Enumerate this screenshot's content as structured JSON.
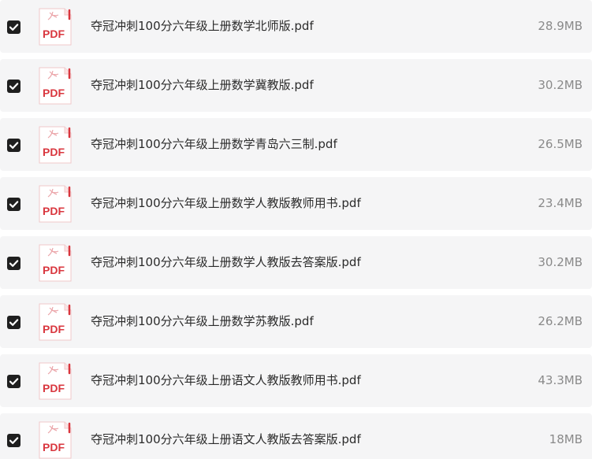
{
  "files": [
    {
      "name": "夺冠冲刺100分六年级上册数学北师版.pdf",
      "size": "28.9MB",
      "checked": true,
      "icon": "pdf-icon",
      "icon_label": "PDF"
    },
    {
      "name": "夺冠冲刺100分六年级上册数学冀教版.pdf",
      "size": "30.2MB",
      "checked": true,
      "icon": "pdf-icon",
      "icon_label": "PDF"
    },
    {
      "name": "夺冠冲刺100分六年级上册数学青岛六三制.pdf",
      "size": "26.5MB",
      "checked": true,
      "icon": "pdf-icon",
      "icon_label": "PDF"
    },
    {
      "name": "夺冠冲刺100分六年级上册数学人教版教师用书.pdf",
      "size": "23.4MB",
      "checked": true,
      "icon": "pdf-icon",
      "icon_label": "PDF"
    },
    {
      "name": "夺冠冲刺100分六年级上册数学人教版去答案版.pdf",
      "size": "30.2MB",
      "checked": true,
      "icon": "pdf-icon",
      "icon_label": "PDF"
    },
    {
      "name": "夺冠冲刺100分六年级上册数学苏教版.pdf",
      "size": "26.2MB",
      "checked": true,
      "icon": "pdf-icon",
      "icon_label": "PDF"
    },
    {
      "name": "夺冠冲刺100分六年级上册语文人教版教师用书.pdf",
      "size": "43.3MB",
      "checked": true,
      "icon": "pdf-icon",
      "icon_label": "PDF"
    },
    {
      "name": "夺冠冲刺100分六年级上册语文人教版去答案版.pdf",
      "size": "18MB",
      "checked": true,
      "icon": "pdf-icon",
      "icon_label": "PDF"
    }
  ],
  "colors": {
    "row_bg": "#f5f5f6",
    "checkbox": "#1f1f1f",
    "pdf_red": "#d9363e",
    "name_text": "#2b2b2b",
    "size_text": "#8a8a8a"
  }
}
